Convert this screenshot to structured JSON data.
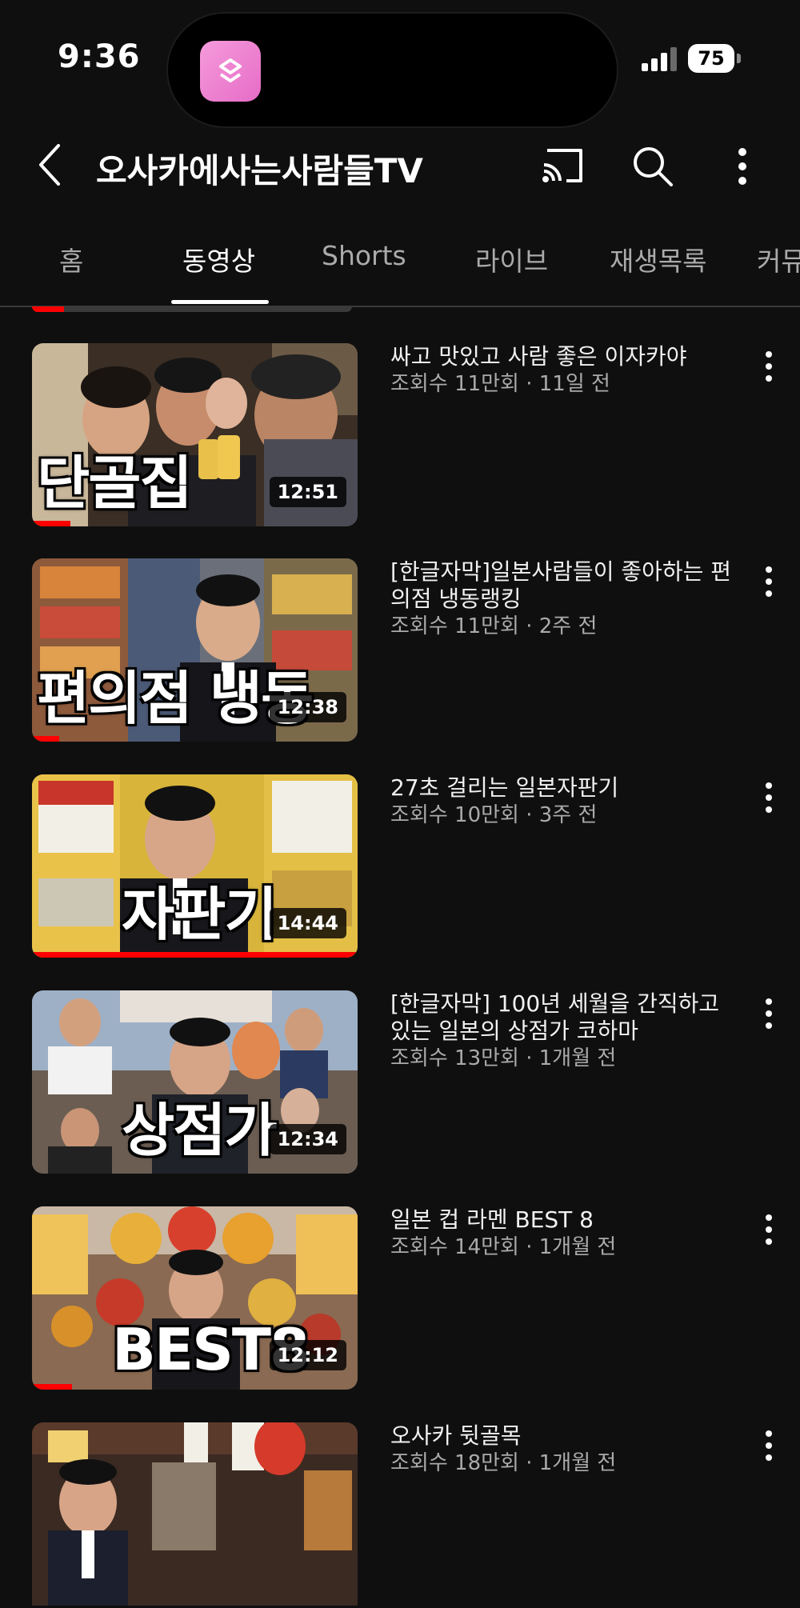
{
  "status_bar": {
    "time": "9:36",
    "battery": "75"
  },
  "header": {
    "channel_name": "오사카에사는사람들TV"
  },
  "tabs": [
    {
      "label": "홈"
    },
    {
      "label": "동영상",
      "active": true
    },
    {
      "label": "Shorts"
    },
    {
      "label": "라이브"
    },
    {
      "label": "재생목록"
    },
    {
      "label": "커뮤"
    }
  ],
  "videos": [
    {
      "title": "싸고 맛있고 사람 좋은 이자카야",
      "meta": "조회수 11만회 · 11일 전",
      "duration": "12:51",
      "thumb_text": "단골집",
      "watched_fraction": 0.12
    },
    {
      "title": "[한글자막]일본사람들이 좋아하는 편의점 냉동랭킹",
      "meta": "조회수 11만회 · 2주 전",
      "duration": "12:38",
      "thumb_text": "편의점 냉동",
      "watched_fraction": 0.08
    },
    {
      "title": "27초 걸리는 일본자판기",
      "meta": "조회수 10만회 · 3주 전",
      "duration": "14:44",
      "thumb_text": "자판기",
      "watched_fraction": 1.0
    },
    {
      "title": "[한글자막] 100년 세월을 간직하고 있는 일본의 상점가 코하마",
      "meta": "조회수 13만회 · 1개월 전",
      "duration": "12:34",
      "thumb_text": "상점가",
      "watched_fraction": 0.0
    },
    {
      "title": "일본 컵 라멘 BEST 8",
      "meta": "조회수 14만회 · 1개월 전",
      "duration": "12:12",
      "thumb_text": "BEST8",
      "watched_fraction": 0.12
    },
    {
      "title": "오사카 뒷골목",
      "meta": "조회수 18만회 · 1개월 전",
      "duration": "",
      "thumb_text": "",
      "watched_fraction": 0.0
    }
  ],
  "colors": {
    "background": "#0f0f0f",
    "accent_red": "#ff0000",
    "secondary_text": "#aaaaaa"
  }
}
